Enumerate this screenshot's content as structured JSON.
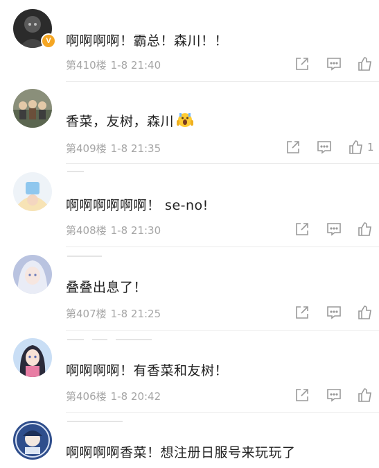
{
  "comments": [
    {
      "avatar": "avatar-dark-portrait",
      "verified": true,
      "verified_badge": "V",
      "username": "",
      "text": "啊啊啊啊！霸总！森川！！",
      "floor": "第410楼",
      "time": "1-8 21:40",
      "likes": ""
    },
    {
      "avatar": "avatar-group-photo",
      "verified": false,
      "username": "",
      "text": "香菜，友树，森川",
      "emoji": "screaming-face-emoji",
      "floor": "第409楼",
      "time": "1-8 21:35",
      "likes": "1"
    },
    {
      "avatar": "avatar-anime-blue",
      "verified": false,
      "username": "",
      "text": "啊啊啊啊啊啊！ se-no!",
      "floor": "第408楼",
      "time": "1-8 21:30",
      "likes": ""
    },
    {
      "avatar": "avatar-anime-silver",
      "verified": false,
      "username": "",
      "text": "叠叠出息了！",
      "floor": "第407楼",
      "time": "1-8 21:25",
      "likes": ""
    },
    {
      "avatar": "avatar-anime-girl",
      "verified": false,
      "username": "",
      "text": "啊啊啊啊！有香菜和友树！",
      "floor": "第406楼",
      "time": "1-8 20:42",
      "likes": ""
    },
    {
      "avatar": "avatar-anime-blue-badge",
      "verified": false,
      "username": "",
      "text": "啊啊啊啊香菜！想注册日服号来玩玩了",
      "floor": "",
      "time": "",
      "likes": ""
    }
  ],
  "icons": {
    "share": "share-icon",
    "comment": "comment-icon",
    "like": "like-icon"
  },
  "colors": {
    "text": "#222222",
    "meta": "#a5a5a5",
    "icon": "#9a9a9a",
    "divider": "#ebebeb",
    "badge": "#f5a623"
  }
}
